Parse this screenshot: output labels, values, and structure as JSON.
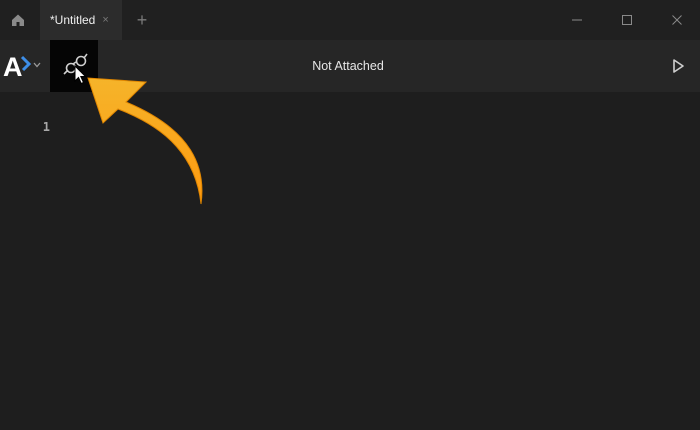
{
  "titlebar": {
    "tabs": [
      {
        "label": "*Untitled",
        "close_glyph": "×",
        "active": true
      }
    ],
    "new_tab_glyph": "+",
    "window_controls": [
      "minimize-icon",
      "maximize-icon",
      "close-icon"
    ]
  },
  "toolbar": {
    "logo_letter": "A",
    "attach_icon": "plug-icon",
    "status": "Not Attached",
    "run_icon": "play-icon"
  },
  "editor": {
    "line_numbers": [
      "1"
    ]
  },
  "colors": {
    "accent": "#3d8ee8",
    "annotation_arrow": "#f39a1a"
  }
}
